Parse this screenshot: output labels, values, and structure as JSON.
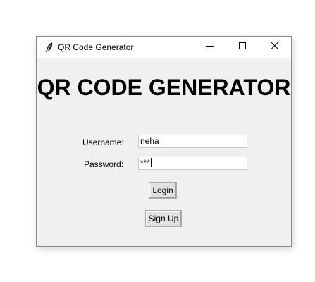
{
  "window": {
    "title": "QR Code Generator",
    "icon": "feather-icon",
    "controls": {
      "minimize": "minimize-icon",
      "maximize": "maximize-icon",
      "close": "close-icon"
    }
  },
  "main": {
    "heading": "QR CODE GENERATOR",
    "username_label": "Username:",
    "username_value": "neha",
    "password_label": "Password:",
    "password_value": "***",
    "login_label": "Login",
    "signup_label": "Sign Up"
  }
}
